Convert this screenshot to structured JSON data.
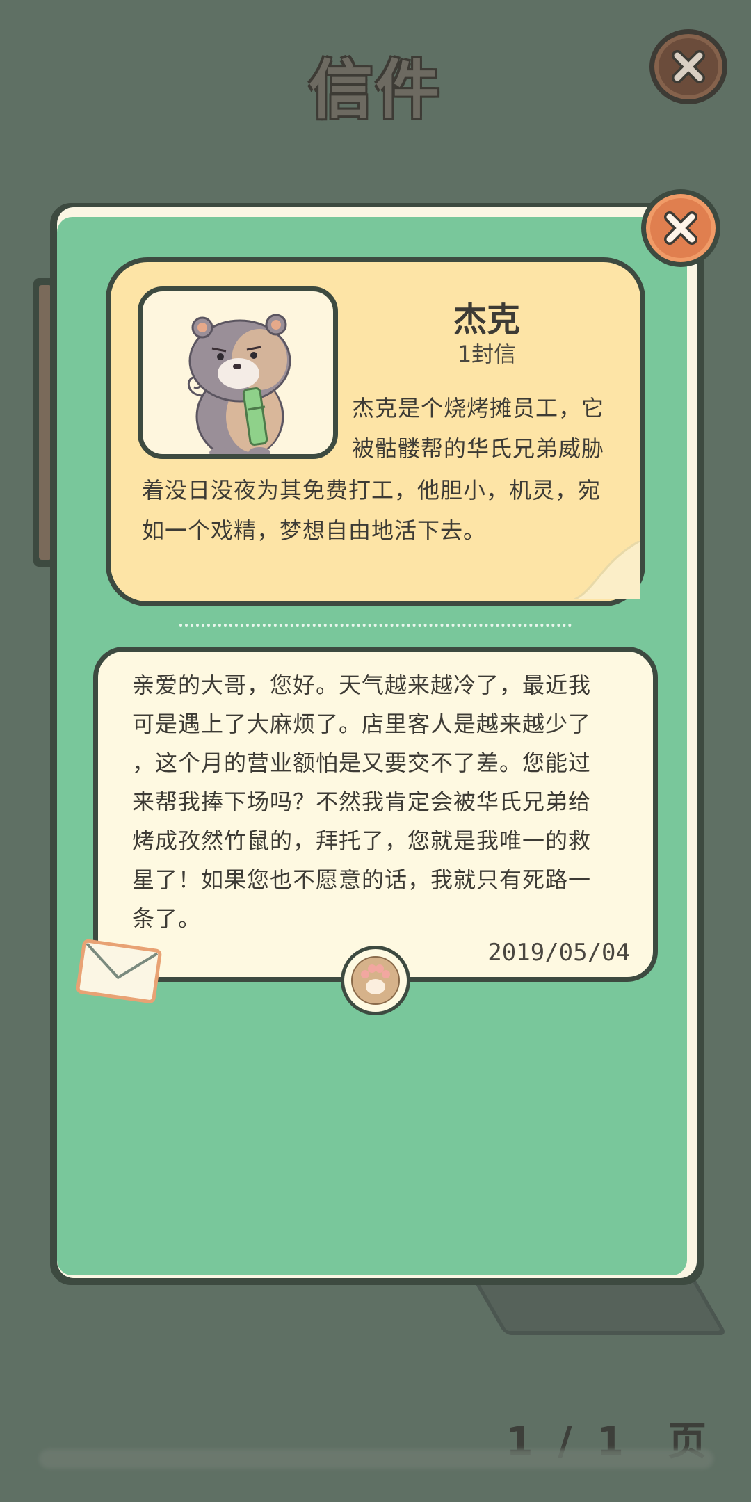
{
  "header": {
    "title": "信件"
  },
  "profile": {
    "name": "杰克",
    "letter_count": "1封信",
    "description_lines": [
      "杰克是个烧烤摊员工，它",
      "被骷髅帮的华氏兄弟威胁",
      "着没日没夜为其免费打工，他胆小，机灵，宛",
      "如一个戏精，梦想自由地活下去。"
    ]
  },
  "letter": {
    "lines": [
      "亲爱的大哥，您好。天气越来越冷了，最近我",
      "可是遇上了大麻烦了。店里客人是越来越少了",
      "，这个月的营业额怕是又要交不了差。您能过",
      "来帮我捧下场吗？不然我肯定会被华氏兄弟给",
      "烤成孜然竹鼠的，拜托了，您就是我唯一的救",
      "星了！如果您也不愿意的话，我就只有死路一",
      "条了。"
    ],
    "date": "2019/05/04"
  },
  "pager": {
    "current": "1",
    "separator": "/",
    "total": "1",
    "unit": "页"
  },
  "icons": {
    "close_top": "close-icon",
    "close_card": "close-icon",
    "envelope": "envelope-icon",
    "paw": "paw-icon",
    "avatar": "bamboo-rat-avatar"
  },
  "colors": {
    "background": "#5f7064",
    "card": "#79c79b",
    "profile_panel": "#fde4a6",
    "letter_panel": "#fef9e1",
    "close_top": "#6b4c3b",
    "close_card": "#e07f4f",
    "outline": "#3d4a40"
  }
}
